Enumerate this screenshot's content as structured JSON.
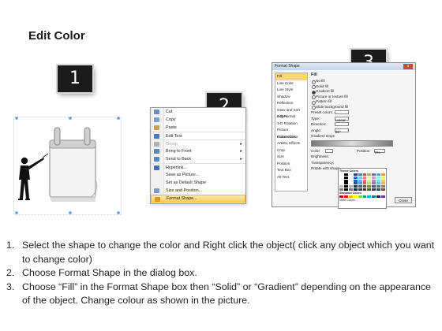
{
  "title": "Edit Color",
  "badges": [
    "1",
    "2",
    "3"
  ],
  "context_menu": {
    "items": [
      {
        "label": "Cut",
        "u": "t",
        "icon": "scissors-icon",
        "color": "#6a8fbf",
        "state": "normal"
      },
      {
        "label": "Copy",
        "u": "C",
        "icon": "copy-icon",
        "color": "#7a9fd0",
        "state": "normal"
      },
      {
        "label": "Paste",
        "u": "P",
        "icon": "paste-icon",
        "color": "#c9a25a",
        "state": "normal"
      },
      {
        "label": "Edit Text",
        "u": "x",
        "icon": "edit-text-icon",
        "color": "#4a7ac0",
        "state": "normal",
        "sep": true
      },
      {
        "label": "Group",
        "u": "G",
        "icon": "group-icon",
        "color": "#b0b0b0",
        "state": "dim",
        "arrow": true,
        "sep": true
      },
      {
        "label": "Bring to Front",
        "u": "r",
        "icon": "bring-front-icon",
        "color": "#5b86c5",
        "state": "normal",
        "arrow": true
      },
      {
        "label": "Send to Back",
        "u": "k",
        "icon": "send-back-icon",
        "color": "#5b86c5",
        "state": "normal",
        "arrow": true
      },
      {
        "label": "Hyperlink...",
        "u": "H",
        "icon": "hyperlink-icon",
        "color": "#3f6fb5",
        "state": "normal",
        "sep": true
      },
      {
        "label": "Save as Picture...",
        "u": "",
        "icon": "",
        "color": "",
        "state": "normal"
      },
      {
        "label": "Set as Default Shape",
        "u": "",
        "icon": "",
        "color": "",
        "state": "normal"
      },
      {
        "label": "Size and Position...",
        "u": "z",
        "icon": "size-position-icon",
        "color": "#7c9cc8",
        "state": "normal"
      },
      {
        "label": "Format Shape...",
        "u": "o",
        "icon": "format-shape-icon",
        "color": "#d89a30",
        "state": "highlighted"
      }
    ]
  },
  "format_dialog": {
    "title": "Format Shape",
    "close": "x",
    "sidebar": [
      "Fill",
      "Line Color",
      "Line Style",
      "Shadow",
      "Reflection",
      "Glow and Soft Edges",
      "3-D Format",
      "3-D Rotation",
      "Picture Corrections",
      "Picture Color",
      "Artistic Effects",
      "Crop",
      "Size",
      "Position",
      "Text Box",
      "Alt Text"
    ],
    "selected": "Fill",
    "heading": "Fill",
    "options": [
      {
        "label": "No fill",
        "on": false
      },
      {
        "label": "Solid fill",
        "on": false
      },
      {
        "label": "Gradient fill",
        "on": true
      },
      {
        "label": "Picture or texture fill",
        "on": false
      },
      {
        "label": "Pattern fill",
        "on": false
      },
      {
        "label": "Slide background fill",
        "on": false
      }
    ],
    "fields": [
      "Preset colors:",
      "Type:",
      "Direction:",
      "Angle:",
      "Gradient stops"
    ],
    "type_value": "Linear",
    "angle_value": "90°",
    "color_label": "Color",
    "position_label": "Position:",
    "position_value": "0%",
    "brightness_label": "Brightness:",
    "transparency_label": "Transparency:",
    "rotate_label": "Rotate with shape",
    "close_button": "Close"
  },
  "palette": {
    "theme_label": "Theme Colors",
    "standard_label": "Standard Colors",
    "more_label": "More Colors...",
    "theme_top": [
      "#ffffff",
      "#000000",
      "#eeece1",
      "#1f497d",
      "#4f81bd",
      "#c0504d",
      "#9bbb59",
      "#8064a2",
      "#4bacc6",
      "#f79646"
    ],
    "standard": [
      "#c00000",
      "#ff0000",
      "#ffc000",
      "#ffff00",
      "#92d050",
      "#00b050",
      "#00b0f0",
      "#0070c0",
      "#002060",
      "#7030a0"
    ]
  },
  "steps": [
    {
      "n": "1.",
      "text": "Select the shape to change the color and Right click the object( click any object which you want to change color)"
    },
    {
      "n": "2.",
      "text": "Choose Format Shape in the dialog box."
    },
    {
      "n": "3.",
      "text": "Choose “Fill” in the Format Shape box then “Solid” or “Gradient” depending on the appearance of the object. Change colour as shown in the picture."
    }
  ]
}
